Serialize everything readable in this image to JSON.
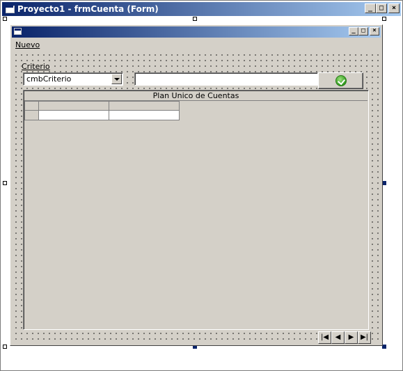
{
  "designer": {
    "title": "Proyecto1 - frmCuenta (Form)",
    "buttons": {
      "minimize": "_",
      "maximize": "□",
      "close": "×"
    }
  },
  "form": {
    "buttons": {
      "minimize": "_",
      "maximize": "□",
      "close": "×"
    },
    "menu": [
      {
        "label": "Nuevo"
      }
    ],
    "criterio_label": "Criterio",
    "combo": {
      "value": "cmbCriterio"
    },
    "search": {
      "value": ""
    },
    "grid": {
      "caption": "Plan Unico de Cuentas"
    },
    "nav": {
      "first": "|◀",
      "prev": "◀",
      "next": "▶",
      "last": "▶|"
    }
  },
  "colors": {
    "titlebar": "#0a246a",
    "face": "#d4d0c8",
    "ok_icon": "#2f9a1e"
  },
  "icons": [
    "form-icon",
    "minimize-icon",
    "maximize-icon",
    "close-icon",
    "dropdown-arrow-icon",
    "checkmark-icon",
    "first-record-icon",
    "prev-record-icon",
    "next-record-icon",
    "last-record-icon"
  ]
}
